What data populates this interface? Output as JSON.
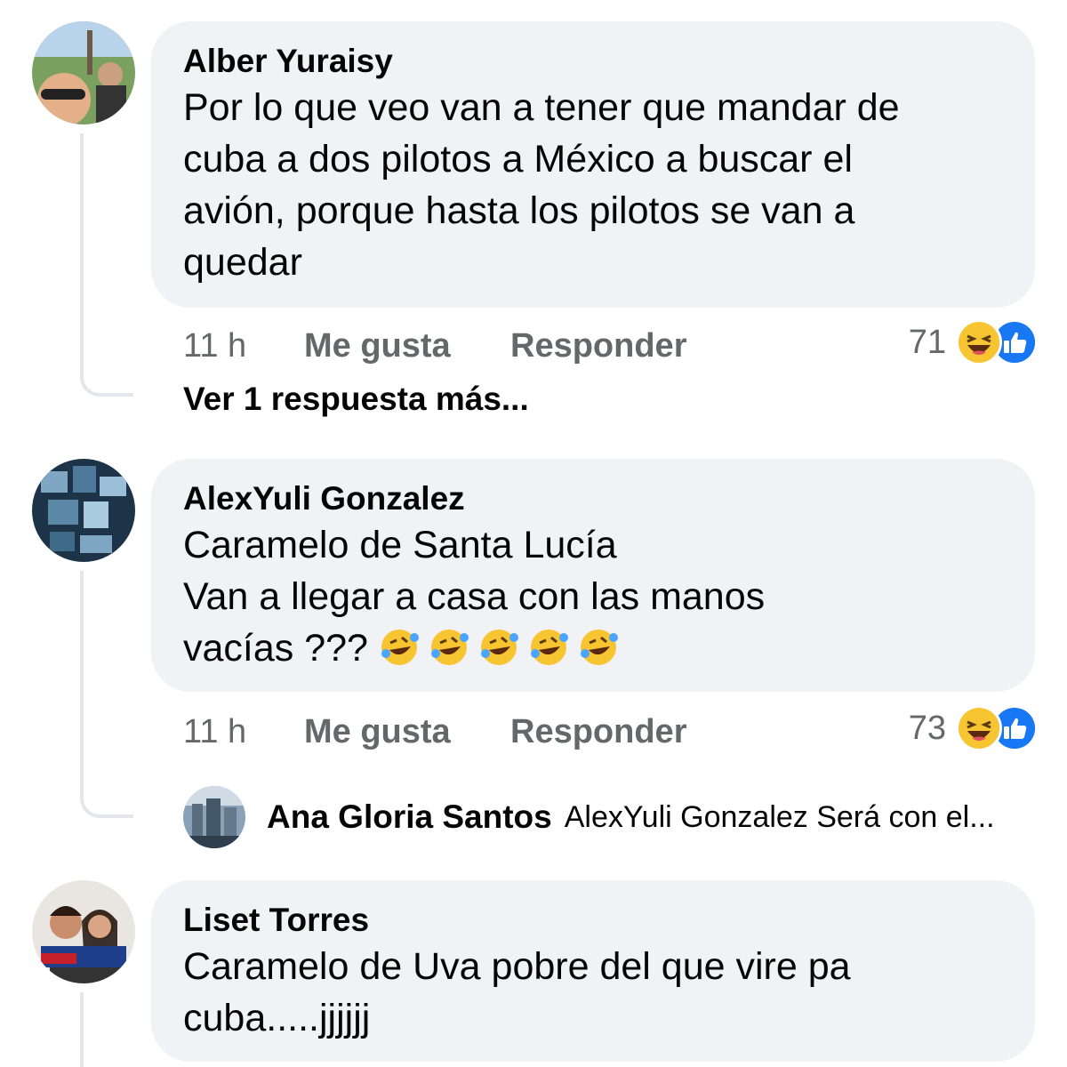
{
  "comments": [
    {
      "author": "Alber Yuraisy",
      "lines": [
        "Por lo que veo van a tener que mandar de",
        "cuba a dos pilotos a México a buscar el",
        "avión, porque hasta los pilotos se van a",
        "quedar"
      ],
      "time": "11 h",
      "like_label": "Me gusta",
      "reply_label": "Responder",
      "reaction_count": "71",
      "reactions": [
        "haha-icon",
        "like-icon"
      ],
      "view_more": "Ver 1 respuesta más..."
    },
    {
      "author": "AlexYuli Gonzalez",
      "lines": [
        "Caramelo de Santa Lucía",
        "Van a llegar a casa con las manos",
        "vacías ???"
      ],
      "emoji_count": 5,
      "time": "11 h",
      "like_label": "Me gusta",
      "reply_label": "Responder",
      "reaction_count": "73",
      "reactions": [
        "haha-icon",
        "like-icon"
      ],
      "reply_preview": {
        "author": "Ana Gloria Santos",
        "text": "AlexYuli Gonzalez Será con el..."
      }
    },
    {
      "author": "Liset Torres",
      "lines": [
        "Caramelo de Uva pobre del que vire pa",
        "cuba.....jjjjjj"
      ]
    }
  ],
  "colors": {
    "bubble": "#f0f2f5",
    "meta": "#65676b",
    "like_blue": "#1877f2",
    "haha_yellow": "#f7c531"
  }
}
